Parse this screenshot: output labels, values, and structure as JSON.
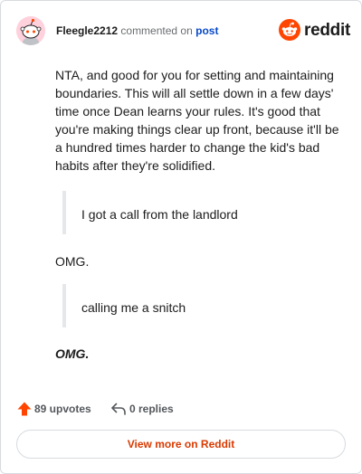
{
  "header": {
    "username": "Fleegle2212",
    "commented_on": "commented on",
    "post_link": "post",
    "brand": "reddit",
    "avatar_icon": "snoo-avatar-icon",
    "logo_icon": "reddit-logo-icon"
  },
  "comment": {
    "paragraph": "NTA, and good for you for setting and maintaining boundaries. This will all settle down in a few days' time once Dean learns your rules. It's good that you're making things clear up front, because it'll be a hundred times harder to change the kid's bad habits after they're solidified.",
    "quote_1": "I got a call from the landlord",
    "reply_1": "OMG.",
    "quote_2": "calling me a snitch",
    "reply_2": "OMG."
  },
  "footer": {
    "upvotes": "89 upvotes",
    "replies": "0 replies",
    "upvote_icon": "upvote-arrow-icon",
    "reply_icon": "reply-arrow-icon"
  },
  "view_more": "View more on Reddit",
  "colors": {
    "accent": "#d93a00",
    "upvote": "#ff4500",
    "link": "#0a4ac6",
    "avatar_bg": "#ffd1dc"
  }
}
